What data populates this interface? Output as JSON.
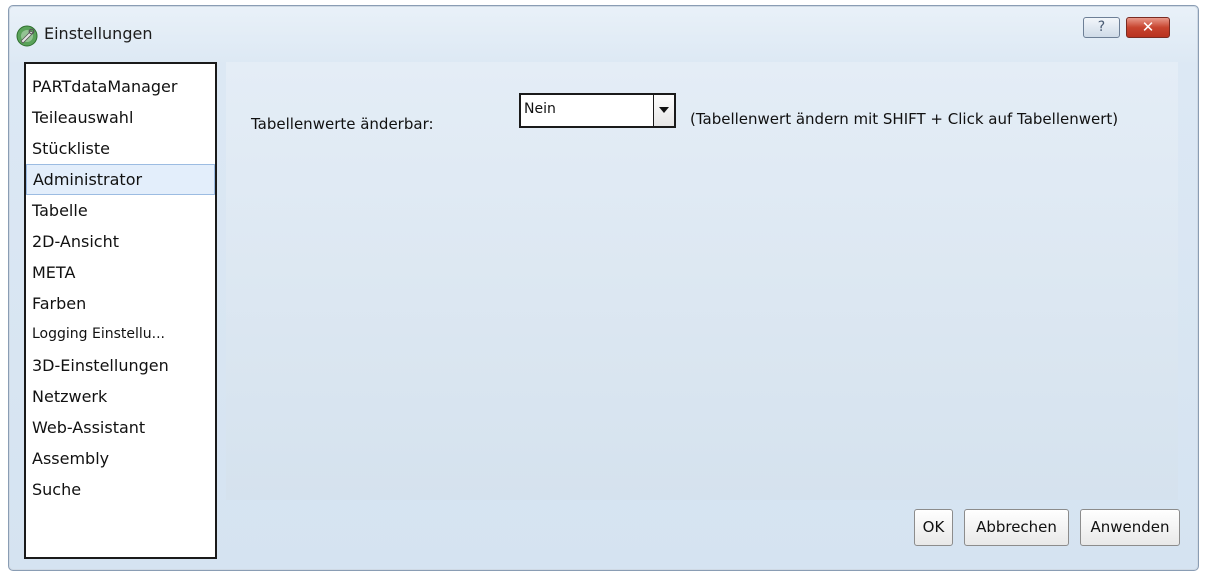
{
  "window": {
    "title": "Einstellungen",
    "icon": "settings-wrench-icon",
    "help_label": "?",
    "close_label": "✕"
  },
  "sidebar": {
    "items": [
      {
        "label": "PARTdataManager"
      },
      {
        "label": "Teileauswahl"
      },
      {
        "label": "Stückliste"
      },
      {
        "label": "Administrator",
        "selected": true
      },
      {
        "label": "Tabelle"
      },
      {
        "label": "2D-Ansicht"
      },
      {
        "label": "META"
      },
      {
        "label": "Farben"
      },
      {
        "label": "Logging Einstellu..."
      },
      {
        "label": "3D-Einstellungen"
      },
      {
        "label": "Netzwerk"
      },
      {
        "label": "Web-Assistant"
      },
      {
        "label": "Assembly"
      },
      {
        "label": "Suche"
      }
    ]
  },
  "main": {
    "setting_label": "Tabellenwerte änderbar:",
    "setting_value": "Nein",
    "hint": "(Tabellenwert ändern mit SHIFT + Click auf Tabellenwert)"
  },
  "footer": {
    "ok_label": "OK",
    "cancel_label": "Abbrechen",
    "apply_label": "Anwenden"
  }
}
